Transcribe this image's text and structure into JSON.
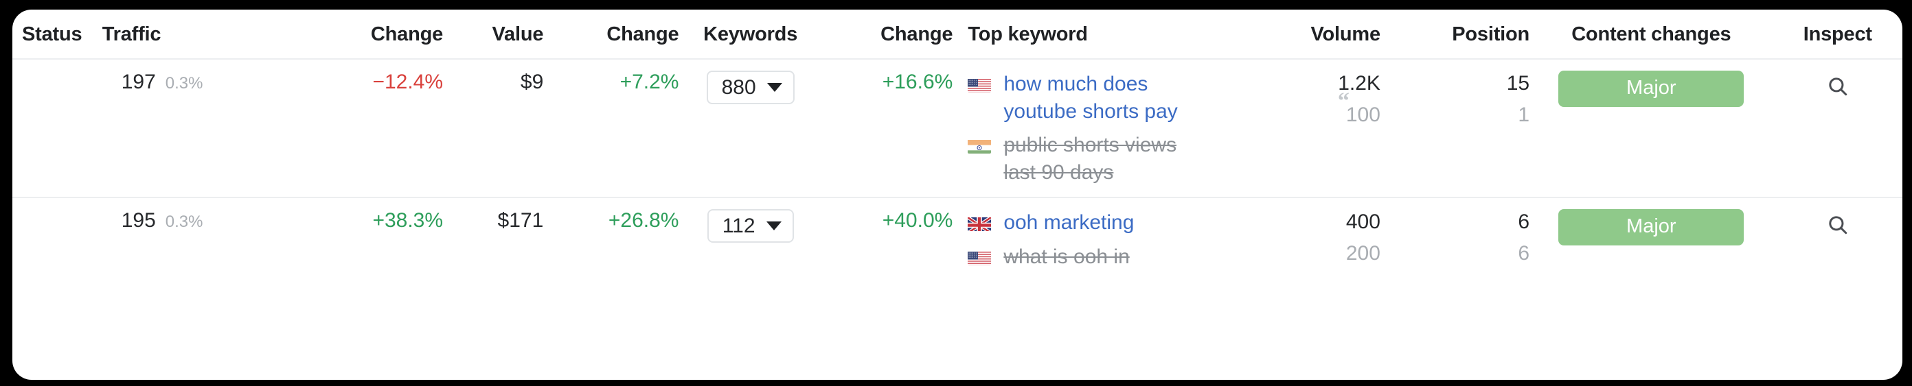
{
  "table": {
    "columns": [
      {
        "key": "status",
        "label": "Status"
      },
      {
        "key": "traffic",
        "label": "Traffic"
      },
      {
        "key": "change1",
        "label": "Change"
      },
      {
        "key": "value",
        "label": "Value"
      },
      {
        "key": "change2",
        "label": "Change"
      },
      {
        "key": "keywords",
        "label": "Keywords"
      },
      {
        "key": "change3",
        "label": "Change"
      },
      {
        "key": "topkw",
        "label": "Top keyword"
      },
      {
        "key": "volume",
        "label": "Volume"
      },
      {
        "key": "position",
        "label": "Position"
      },
      {
        "key": "content",
        "label": "Content changes"
      },
      {
        "key": "inspect",
        "label": "Inspect"
      }
    ],
    "rows": [
      {
        "status": "",
        "traffic_value": "197",
        "traffic_share": "0.3%",
        "traffic_change": "−12.4%",
        "traffic_change_dir": "negative",
        "value": "$9",
        "value_change": "+7.2%",
        "value_change_dir": "positive",
        "keywords_count": "880",
        "keywords_change": "+16.6%",
        "keywords_change_dir": "positive",
        "top_keywords": [
          {
            "flag": "us-flag-icon",
            "text": "how much does youtube shorts pay",
            "struck": false
          },
          {
            "flag": "in-flag-icon",
            "text": "public shorts views last 90 days",
            "struck": true
          }
        ],
        "volume": [
          "1.2K",
          "100"
        ],
        "position": [
          "15",
          "1"
        ],
        "serp_feature_icon": "featured-snippet-quote-icon",
        "content_change": "Major",
        "inspect_icon": "search-icon"
      },
      {
        "status": "",
        "traffic_value": "195",
        "traffic_share": "0.3%",
        "traffic_change": "+38.3%",
        "traffic_change_dir": "positive",
        "value": "$171",
        "value_change": "+26.8%",
        "value_change_dir": "positive",
        "keywords_count": "112",
        "keywords_change": "+40.0%",
        "keywords_change_dir": "positive",
        "top_keywords": [
          {
            "flag": "gb-flag-icon",
            "text": "ooh marketing",
            "struck": false
          },
          {
            "flag": "us-flag-icon",
            "text": "what is ooh in",
            "struck": true
          }
        ],
        "volume": [
          "400",
          "200"
        ],
        "position": [
          "6",
          "6"
        ],
        "serp_feature_icon": "",
        "content_change": "Major",
        "inspect_icon": "search-icon"
      }
    ]
  },
  "colors": {
    "positive": "#2e9e5b",
    "negative": "#d9413c",
    "link": "#3b6bc4",
    "muted": "#a9adb2",
    "badge_major": "#8fc98a",
    "panel_bg": "#ffffff",
    "page_bg": "#000000",
    "row_divider": "#eceef0"
  }
}
